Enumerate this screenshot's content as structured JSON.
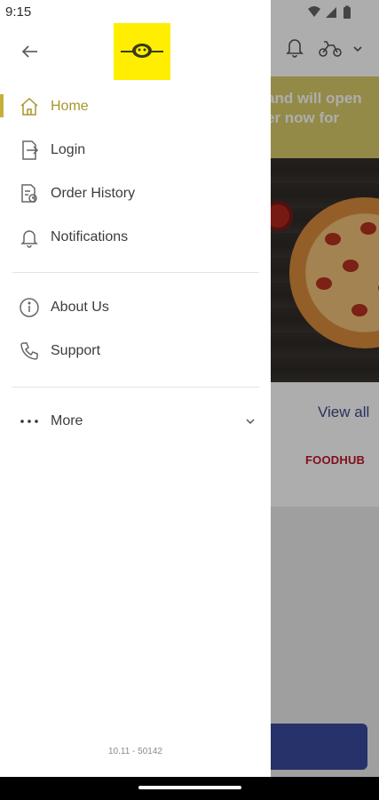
{
  "status_bar": {
    "time": "9:15"
  },
  "background": {
    "banner_lines": [
      "and will open",
      "er now for"
    ],
    "section_link": "View all",
    "brand": "FOODHUB"
  },
  "drawer": {
    "nav_items": [
      {
        "label": "Home",
        "icon": "home-icon",
        "active": true
      },
      {
        "label": "Login",
        "icon": "login-icon"
      },
      {
        "label": "Order History",
        "icon": "order-history-icon"
      },
      {
        "label": "Notifications",
        "icon": "bell-icon"
      },
      {
        "label": "About Us",
        "icon": "info-icon"
      },
      {
        "label": "Support",
        "icon": "phone-icon"
      },
      {
        "label": "More",
        "icon": "more-dots-icon"
      }
    ],
    "version": "10.11 - 50142"
  },
  "colors": {
    "accent": "#a8962a",
    "logo_bg": "#ffee00",
    "banner_bg": "#d9cc6a",
    "cta_bg": "#3a4a9e"
  }
}
